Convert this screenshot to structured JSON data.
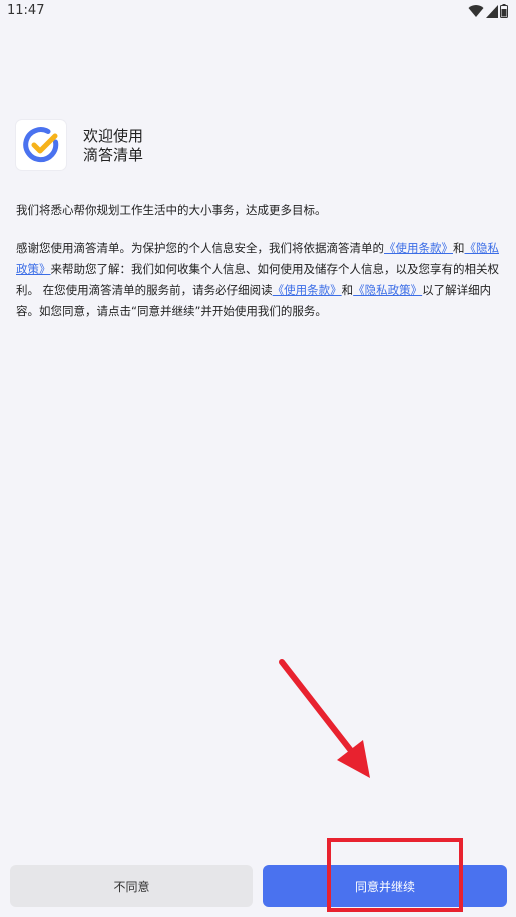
{
  "status_bar": {
    "time": "11:47"
  },
  "app": {
    "welcome_line1": "欢迎使用",
    "welcome_line2": "滴答清单"
  },
  "intro_text": "我们将悉心帮你规划工作生活中的大小事务，达成更多目标。",
  "agreement": {
    "part1": "感谢您使用滴答清单。为保护您的个人信息安全，我们将依据滴答清单的",
    "terms_link": "《使用条款》",
    "and1": "和",
    "privacy_link": "《隐私政策》",
    "part2": "来帮助您了解：我们如何收集个人信息、如何使用及储存个人信息，以及您享有的相关权利。 在您使用滴答清单的服务前，请务必仔细阅读",
    "terms_link2": "《使用条款》",
    "and2": "和",
    "privacy_link2": "《隐私政策》",
    "part3": "以了解详细内容。如您同意，请点击“同意并继续”并开始使用我们的服务。"
  },
  "buttons": {
    "disagree": "不同意",
    "agree": "同意并继续"
  },
  "colors": {
    "accent": "#4a72ef",
    "link": "#3b6de6",
    "annotation_red": "#e8222f",
    "logo_blue": "#4a72ef",
    "logo_yellow": "#f6b21b"
  },
  "icons": [
    "wifi-icon",
    "signal-icon",
    "battery-icon",
    "app-logo-icon",
    "red-arrow-annotation"
  ]
}
